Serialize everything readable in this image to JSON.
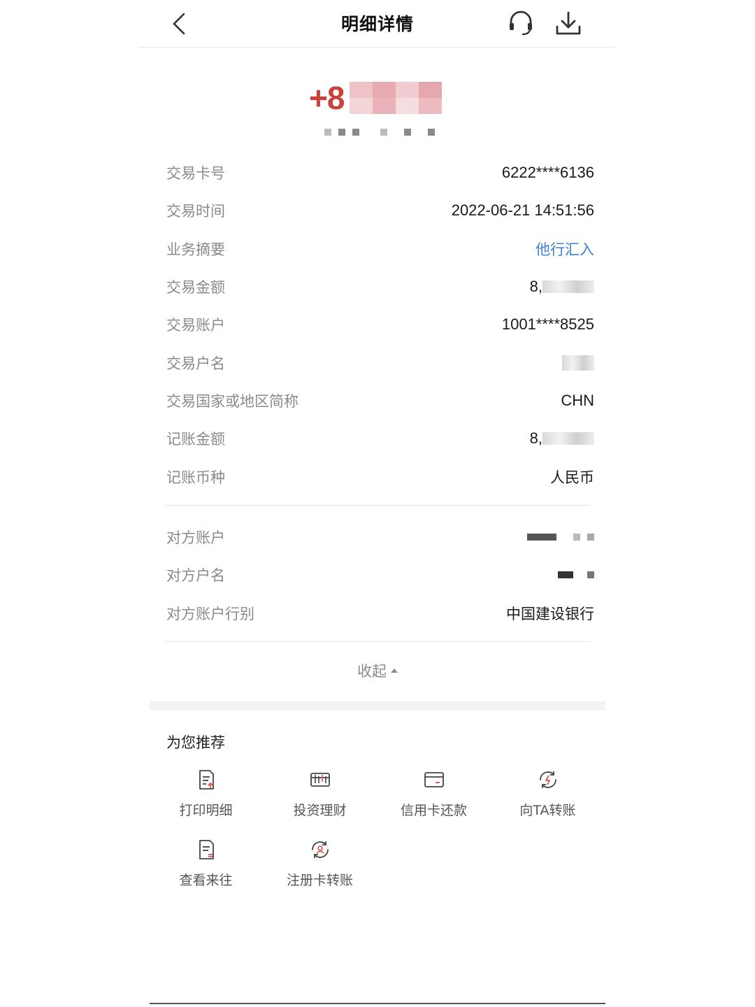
{
  "header": {
    "title": "明细详情",
    "back_icon": "chevron-left-icon",
    "support_icon": "headset-icon",
    "download_icon": "download-icon"
  },
  "amount": {
    "sign_prefix": "+8"
  },
  "details": [
    {
      "label": "交易卡号",
      "value": "6222****6136"
    },
    {
      "label": "交易时间",
      "value": "2022-06-21 14:51:56"
    },
    {
      "label": "业务摘要",
      "value": "他行汇入"
    },
    {
      "label": "交易金额",
      "value": "8,"
    },
    {
      "label": "交易账户",
      "value": "1001****8525"
    },
    {
      "label": "交易户名",
      "value": ""
    },
    {
      "label": "交易国家或地区简称",
      "value": "CHN"
    },
    {
      "label": "记账金额",
      "value": "8,"
    },
    {
      "label": "记账币种",
      "value": "人民币"
    }
  ],
  "counterparty": [
    {
      "label": "对方账户",
      "value": ""
    },
    {
      "label": "对方户名",
      "value": ""
    },
    {
      "label": "对方账户行别",
      "value": "中国建设银行"
    }
  ],
  "collapse_label": "收起",
  "recommend": {
    "title": "为您推荐",
    "items": [
      {
        "label": "打印明细",
        "icon": "print-statement-icon"
      },
      {
        "label": "投资理财",
        "icon": "investment-icon"
      },
      {
        "label": "信用卡还款",
        "icon": "credit-card-icon"
      },
      {
        "label": "向TA转账",
        "icon": "transfer-icon"
      },
      {
        "label": "查看来往",
        "icon": "history-icon"
      },
      {
        "label": "注册卡转账",
        "icon": "registered-card-transfer-icon"
      }
    ]
  },
  "colors": {
    "accent_red": "#c8413b",
    "link_blue": "#3d7fd8",
    "label_gray": "#8a8a8a",
    "icon_red": "#d9534f"
  }
}
